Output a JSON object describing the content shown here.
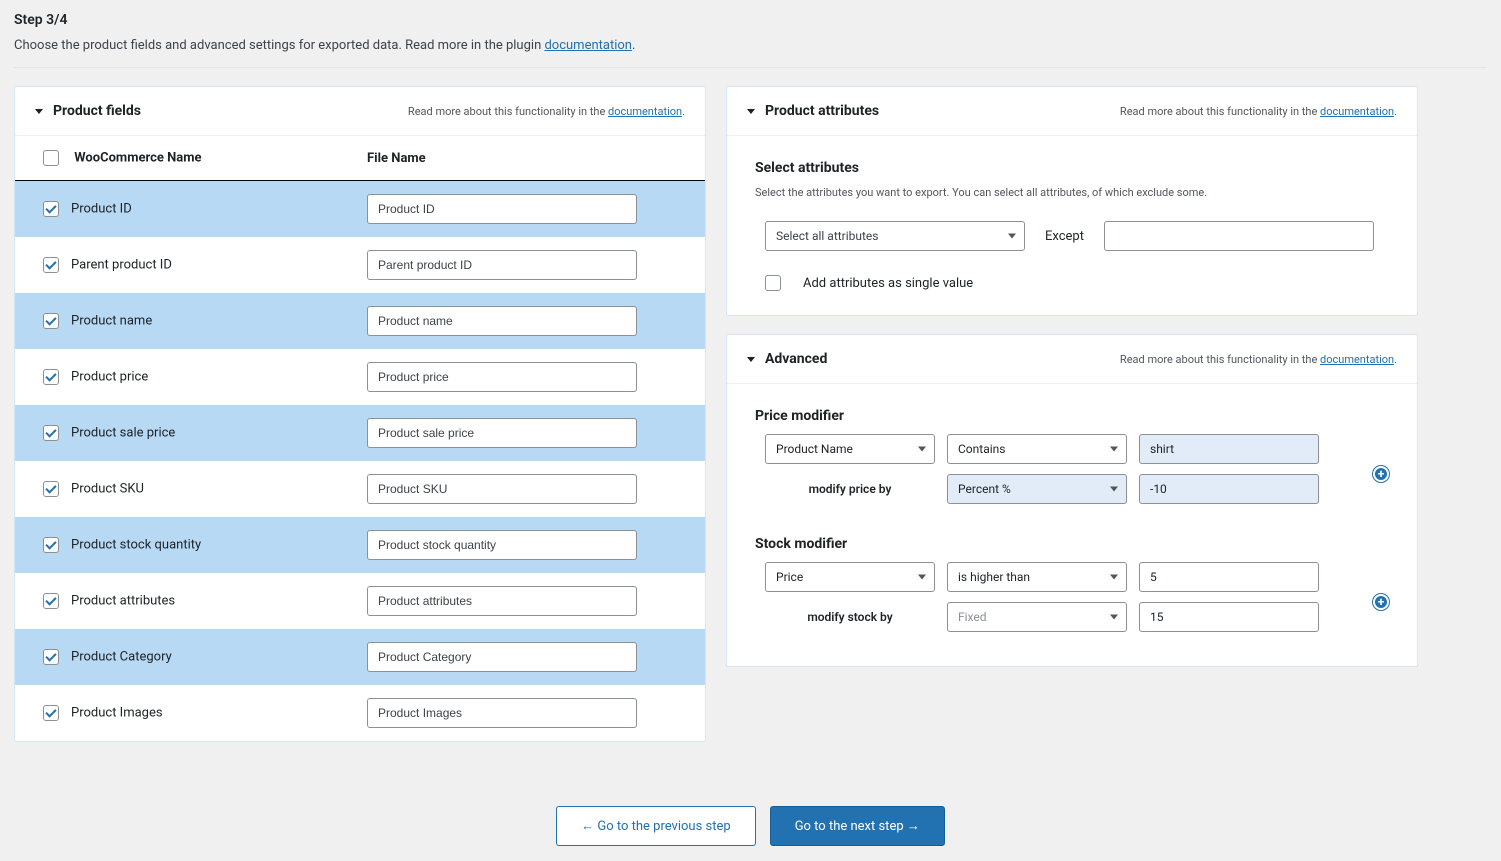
{
  "step": {
    "title": "Step 3/4",
    "subtitle_prefix": "Choose the product fields and advanced settings for exported data. Read more in the plugin ",
    "doc_link": "documentation",
    "subtitle_suffix": "."
  },
  "doc_line_prefix": "Read more about this functionality in the ",
  "doc_line_link": "documentation",
  "doc_line_suffix": ".",
  "product_fields_panel": {
    "title": "Product fields",
    "col_name": "WooCommerce Name",
    "col_file": "File Name",
    "rows": [
      {
        "name": "Product ID",
        "file": "Product ID",
        "checked": true
      },
      {
        "name": "Parent product ID",
        "file": "Parent product ID",
        "checked": true
      },
      {
        "name": "Product name",
        "file": "Product name",
        "checked": true
      },
      {
        "name": "Product price",
        "file": "Product price",
        "checked": true
      },
      {
        "name": "Product sale price",
        "file": "Product sale price",
        "checked": true
      },
      {
        "name": "Product SKU",
        "file": "Product SKU",
        "checked": true
      },
      {
        "name": "Product stock quantity",
        "file": "Product stock quantity",
        "checked": true
      },
      {
        "name": "Product attributes",
        "file": "Product attributes",
        "checked": true
      },
      {
        "name": "Product Category",
        "file": "Product Category",
        "checked": true
      },
      {
        "name": "Product Images",
        "file": "Product Images",
        "checked": true
      }
    ]
  },
  "attributes_panel": {
    "title": "Product attributes",
    "section_title": "Select attributes",
    "section_desc": "Select the attributes you want to export. You can select all attributes, of which exclude some.",
    "select_all_label": "Select all attributes",
    "except_label": "Except",
    "single_value_label": "Add attributes as single value"
  },
  "advanced_panel": {
    "title": "Advanced",
    "price_title": "Price modifier",
    "price_field": "Product Name",
    "price_op": "Contains",
    "price_val": "shirt",
    "price_modify_label": "modify price by",
    "price_modify_type": "Percent %",
    "price_modify_val": "-10",
    "stock_title": "Stock modifier",
    "stock_field": "Price",
    "stock_op": "is higher than",
    "stock_val": "5",
    "stock_modify_label": "modify stock by",
    "stock_modify_type": "Fixed",
    "stock_modify_val": "15"
  },
  "buttons": {
    "prev": "← Go to the previous step",
    "next": "Go to the next step →"
  }
}
